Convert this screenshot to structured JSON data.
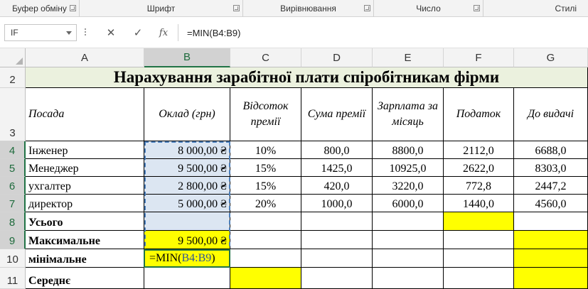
{
  "ribbon": {
    "groups": [
      {
        "label": "Буфер обміну"
      },
      {
        "label": "Шрифт"
      },
      {
        "label": "Вирівнювання"
      },
      {
        "label": "Число"
      },
      {
        "label": "Стилі"
      }
    ]
  },
  "formula_bar": {
    "name_box": "IF",
    "cancel_icon": "✕",
    "enter_icon": "✓",
    "fx_label": "fx",
    "formula": "=MIN(B4:B9)"
  },
  "columns": [
    "A",
    "B",
    "C",
    "D",
    "E",
    "F",
    "G"
  ],
  "rows": [
    "2",
    "3",
    "4",
    "5",
    "6",
    "7",
    "8",
    "9",
    "10",
    "11"
  ],
  "sheet": {
    "title": "Нарахування зарабітної плати спіробітникам фірми",
    "headers": [
      "Посада",
      "Оклад (грн)",
      "Відсоток премії",
      "Сума премії",
      "Зарплата за місяць",
      "Податок",
      "До видачі"
    ],
    "data": [
      [
        "Інженер",
        "8 000,00 ₴",
        "10%",
        "800,0",
        "8800,0",
        "2112,0",
        "6688,0"
      ],
      [
        "Менеджер",
        "9 500,00 ₴",
        "15%",
        "1425,0",
        "10925,0",
        "2622,0",
        "8303,0"
      ],
      [
        "ухгалтер",
        "2 800,00 ₴",
        "15%",
        "420,0",
        "3220,0",
        "772,8",
        "2447,2"
      ],
      [
        "директор",
        "5 000,00 ₴",
        "20%",
        "1000,0",
        "6000,0",
        "1440,0",
        "4560,0"
      ]
    ],
    "summary": {
      "total_label": "Усього",
      "max_label": "Максимальне",
      "max_value": "9 500,00 ₴",
      "min_label": "мінімальне",
      "editing_prefix": "=MIN(",
      "editing_ref": "B4:B9",
      "editing_suffix": ")",
      "avg_label": "Середнє"
    }
  },
  "colors": {
    "highlight": "#ffff00",
    "title_fill": "#ebf1de",
    "selection_fill": "#dce6f2",
    "excel_green": "#217346"
  }
}
